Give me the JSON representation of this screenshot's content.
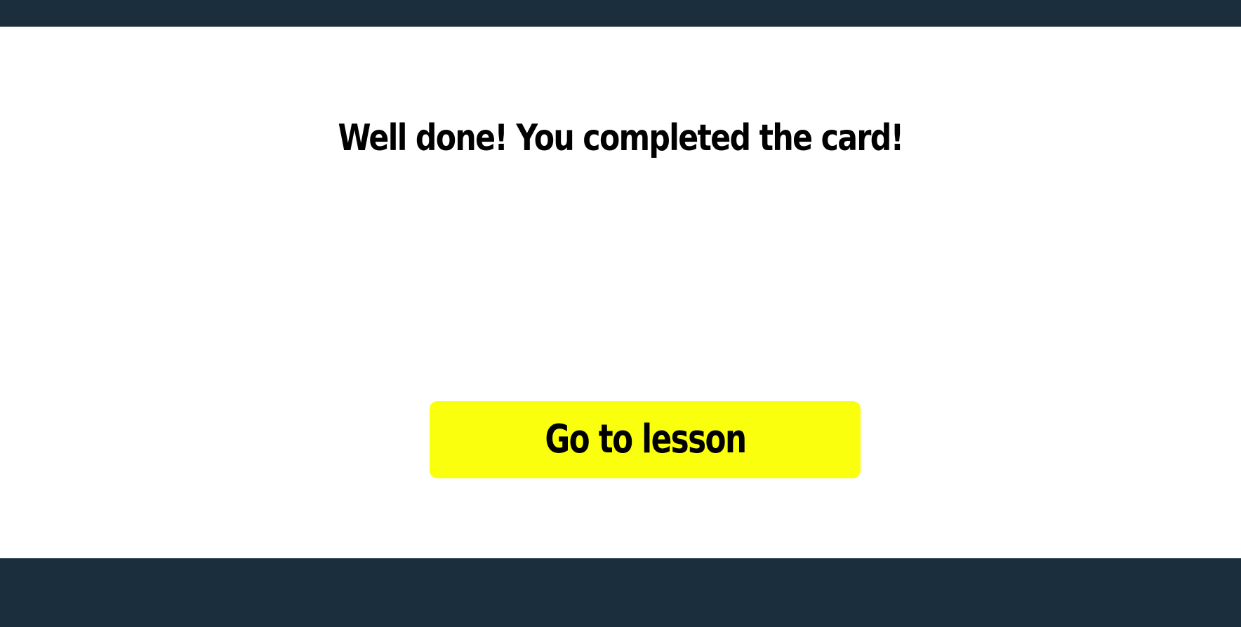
{
  "colors": {
    "bar_background": "#1b2e3d",
    "page_background": "#ffffff",
    "button_background": "#faff0d",
    "text": "#000000"
  },
  "completion": {
    "message": "Well done! You completed the card!"
  },
  "actions": {
    "go_to_lesson_label": "Go to lesson"
  }
}
